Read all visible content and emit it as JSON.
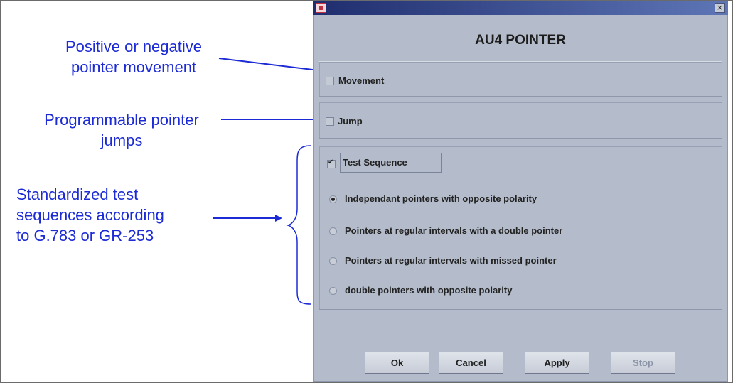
{
  "annotations": {
    "movement": [
      "Positive or negative",
      "pointer movement"
    ],
    "jumps": [
      "Programmable pointer",
      "jumps"
    ],
    "sequences": [
      "Standardized test",
      "sequences according",
      "to G.783 or GR-253"
    ]
  },
  "dialog": {
    "title": "AU4 POINTER",
    "close_glyph": "×",
    "movement": {
      "label": "Movement",
      "checked": false
    },
    "jump": {
      "label": "Jump",
      "checked": false
    },
    "test_sequence": {
      "label": "Test Sequence",
      "checked": true
    },
    "options": [
      {
        "label": "Independant pointers with opposite polarity",
        "selected": true
      },
      {
        "label": "Pointers at regular intervals with a double pointer",
        "selected": false
      },
      {
        "label": "Pointers at regular intervals with missed pointer",
        "selected": false
      },
      {
        "label": "double pointers with opposite polarity",
        "selected": false
      }
    ],
    "buttons": {
      "ok": "Ok",
      "cancel": "Cancel",
      "apply": "Apply",
      "stop": "Stop"
    }
  },
  "colors": {
    "annotation": "#1c2bd6",
    "dialog_bg": "#b4bccb",
    "titlebar_start": "#1f2d6e",
    "titlebar_end": "#5e76b6"
  }
}
